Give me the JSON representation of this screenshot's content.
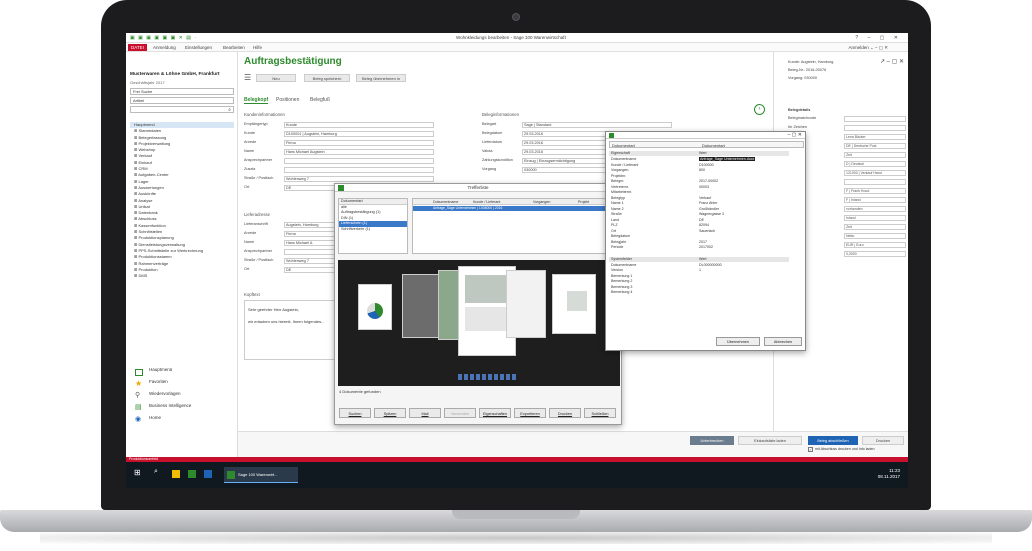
{
  "titlebar": {
    "icons": "▣ ▣ ▣ ▣ ▣ ▣ ✕ ▤ ·",
    "title": "Wohnkleidungs bearbeiten - Sage 100 Warenwirtschaft",
    "controls": "? – ▢ ✕"
  },
  "ribbon": {
    "tabs": [
      "DATEI",
      "Anmeldung",
      "Einstellungen",
      "Bearbeiten",
      "Hilfe"
    ],
    "user": "Anmelden ⌄  –  ▢  ✕"
  },
  "sidebar": {
    "company": "Musterwaren & Löhne GmbH, Frankfurt",
    "date": "Geschäftsjahr 2017",
    "search_label": "Frei Suche",
    "filter_label": "Artikel",
    "tree": [
      "Hauptmenü",
      "Stammdaten",
      "Belegerfassung",
      "Projektverwaltung",
      "Webshop",
      "Verkauf",
      "Einkauf",
      "CRM",
      "Aufgaben-Center",
      "Lager",
      "Auswertungen",
      "Auskünfte",
      "Analyse",
      "Unikat",
      "Datenbank",
      "Abschluss",
      "Kassenfunktion",
      "Schnittstellen",
      "Produktionsplanung",
      "Dienstleistungsverwaltung",
      "PPS-Schnittstelle zur Werkrechnung",
      "Produktionsstamm",
      "Rahmenverträge",
      "Produktion",
      "DMS"
    ],
    "nav": [
      "Hauptmenü",
      "Favoriten",
      "Wiedervorlagen",
      "Business Intelligence",
      "Home"
    ]
  },
  "main": {
    "title": "Auftragsbestätigung",
    "toolbar": [
      "Neu",
      "Beleg speichern",
      "Beleg übernehmen in"
    ],
    "tabs": [
      "Belegkopf",
      "Positionen",
      "Belegfuß"
    ],
    "sections": {
      "kunde": "Kundeninformationen",
      "beleg": "Beleginformationen",
      "liefer": "Lieferadresse",
      "freitext": "Kopftext"
    },
    "kunde_fields": [
      {
        "label": "Empfängertyp",
        "value": "Kunde"
      },
      {
        "label": "Kunde",
        "value": "D100001 | Augstein, Hamburg"
      },
      {
        "label": "Anrede",
        "value": "Firma"
      },
      {
        "label": "Name",
        "value": "Hans Michael Augstein"
      },
      {
        "label": "Ansprechpartner",
        "value": ""
      },
      {
        "label": "Zusatz",
        "value": ""
      },
      {
        "label": "Straße / Postfach",
        "value": "Wohlenweg 7"
      },
      {
        "label": "Ort",
        "value": "DE"
      }
    ],
    "beleg_fields": [
      {
        "label": "Belegart",
        "value": "Sage | Standard"
      },
      {
        "label": "Belegdatum",
        "value": "29.03.2016"
      },
      {
        "label": "Lieferdatum",
        "value": "29.03.2016"
      },
      {
        "label": "Valuta",
        "value": "29.03.2016"
      },
      {
        "label": "Zahlungskondition",
        "value": "Einzug | Einzugsermächtigung"
      },
      {
        "label": "Vorgang",
        "value": "030000"
      }
    ],
    "liefer_fields": [
      {
        "label": "Lieferanschrift",
        "value": "Augstein, Hamburg"
      },
      {
        "label": "Anrede",
        "value": "Firma"
      },
      {
        "label": "Name",
        "value": "Hans Michael A"
      },
      {
        "label": "Ansprechpartner",
        "value": ""
      },
      {
        "label": "Straße / Postfach",
        "value": "Wohlenweg 7"
      },
      {
        "label": "Ort",
        "value": "DE"
      }
    ],
    "kopftext_line1": "Sehr geehrter Herr Augstein,",
    "kopftext_line2": "wir erlauben uns hiermit, Ihnen folgendes..."
  },
  "right_panel": {
    "top_lines": [
      "Kunde:  Augstein, Hamburg",
      "Beleg-Nr.: 2016-00076",
      "Vorgang:  030000"
    ],
    "section": "Belegdetails",
    "fields": [
      {
        "label": "Belegmatchcode",
        "value": ""
      },
      {
        "label": "Ihr Zeichen",
        "value": ""
      },
      {
        "label": "",
        "value": "Lena Bäcker"
      },
      {
        "label": "",
        "value": "DE | Deutsche Post"
      },
      {
        "label": "",
        "value": "Zeit"
      },
      {
        "label": "",
        "value": "D | Deutsch"
      },
      {
        "label": "",
        "value": "121000 | Verkauf Hand"
      },
      {
        "label": "",
        "value": ""
      },
      {
        "label": "",
        "value": "F | Frank Hood"
      },
      {
        "label": "",
        "value": "F | Inland"
      },
      {
        "label": "",
        "value": "vorhanden"
      },
      {
        "label": "",
        "value": "Inland"
      },
      {
        "label": "",
        "value": "Zeit"
      },
      {
        "label": "",
        "value": "Netto"
      },
      {
        "label": "",
        "value": "EUR | Euro"
      },
      {
        "label": "",
        "value": "0,0000"
      }
    ]
  },
  "bottom": {
    "buttons": [
      "Unterbrechen",
      "Einkaufsliste laden",
      "Beleg abschließen",
      "Drucken"
    ],
    "checkbox": "mit Abschluss drucken und Info laden"
  },
  "statusbar": "Produktionsumfeld",
  "taskbar": {
    "app": "Sage 100 Warenwirt...",
    "time": "11:23",
    "date": "08.11.2017"
  },
  "dialog": {
    "title": "Trefferliste",
    "doc_types_header": "Dokumentart",
    "doc_types": [
      "alle",
      "Auftragsbestätigung (1)",
      "DIN (1)",
      "Lieferschein (1)",
      "Schriftverkehr (1)"
    ],
    "table_headers": [
      "Dokumentname",
      "Kunde / Lieferant",
      "Vorgangen",
      "Projekt"
    ],
    "table_row": "Anfrage_Sage Unternehmen | 1008000 | 2016",
    "count": "4 Dokumente gefunden",
    "buttons": [
      "Suchen",
      "Spitzen",
      "Mail",
      "Versenden",
      "Eigenschaften",
      "Exportieren",
      "Drucken",
      "Schließen"
    ],
    "disabled_button": "Versenden"
  },
  "props": {
    "col1": "Dokumentart",
    "col2": "Dokumentart",
    "header_k": "Eigenschaft",
    "header_v": "Wert",
    "rows": [
      {
        "k": "Dokumentname",
        "v": "Anfrage_Sage Unternehmen.docx",
        "hi": true
      },
      {
        "k": "Kunde / Lieferant",
        "v": "D100000"
      },
      {
        "k": "Vorgangen.",
        "v": "800"
      },
      {
        "k": "Projektnr.",
        "v": ""
      },
      {
        "k": "Belegnr.",
        "v": "2017-00002"
      },
      {
        "k": "Vertreternr.",
        "v": "00003"
      },
      {
        "k": "Mitarbeiternr.",
        "v": ""
      },
      {
        "k": "Belegtyp",
        "v": "Verkauf"
      },
      {
        "k": "Name 1",
        "v": "Franz Ahler"
      },
      {
        "k": "Name 2",
        "v": "Großhändler"
      },
      {
        "k": "Straße",
        "v": "Wagnergasse 3"
      },
      {
        "k": "Land",
        "v": "DE"
      },
      {
        "k": "PLZ",
        "v": "82094"
      },
      {
        "k": "Ort",
        "v": "Sauerlach"
      },
      {
        "k": "Belegdatum",
        "v": ""
      },
      {
        "k": "Belegjahr",
        "v": "2017"
      },
      {
        "k": "Periode",
        "v": "2017002"
      }
    ],
    "extra_header_k": "Systemfelder",
    "extra_header_v": "Wert",
    "extra_rows": [
      {
        "k": "Dokumentname",
        "v": "DL000000000"
      },
      {
        "k": "Version",
        "v": "1"
      },
      {
        "k": "Bemerkung 1",
        "v": ""
      },
      {
        "k": "Bemerkung 2",
        "v": ""
      },
      {
        "k": "Bemerkung 3",
        "v": ""
      },
      {
        "k": "Bemerkung 4",
        "v": ""
      }
    ],
    "buttons": [
      "Übernehmen",
      "Abbrechen"
    ]
  }
}
